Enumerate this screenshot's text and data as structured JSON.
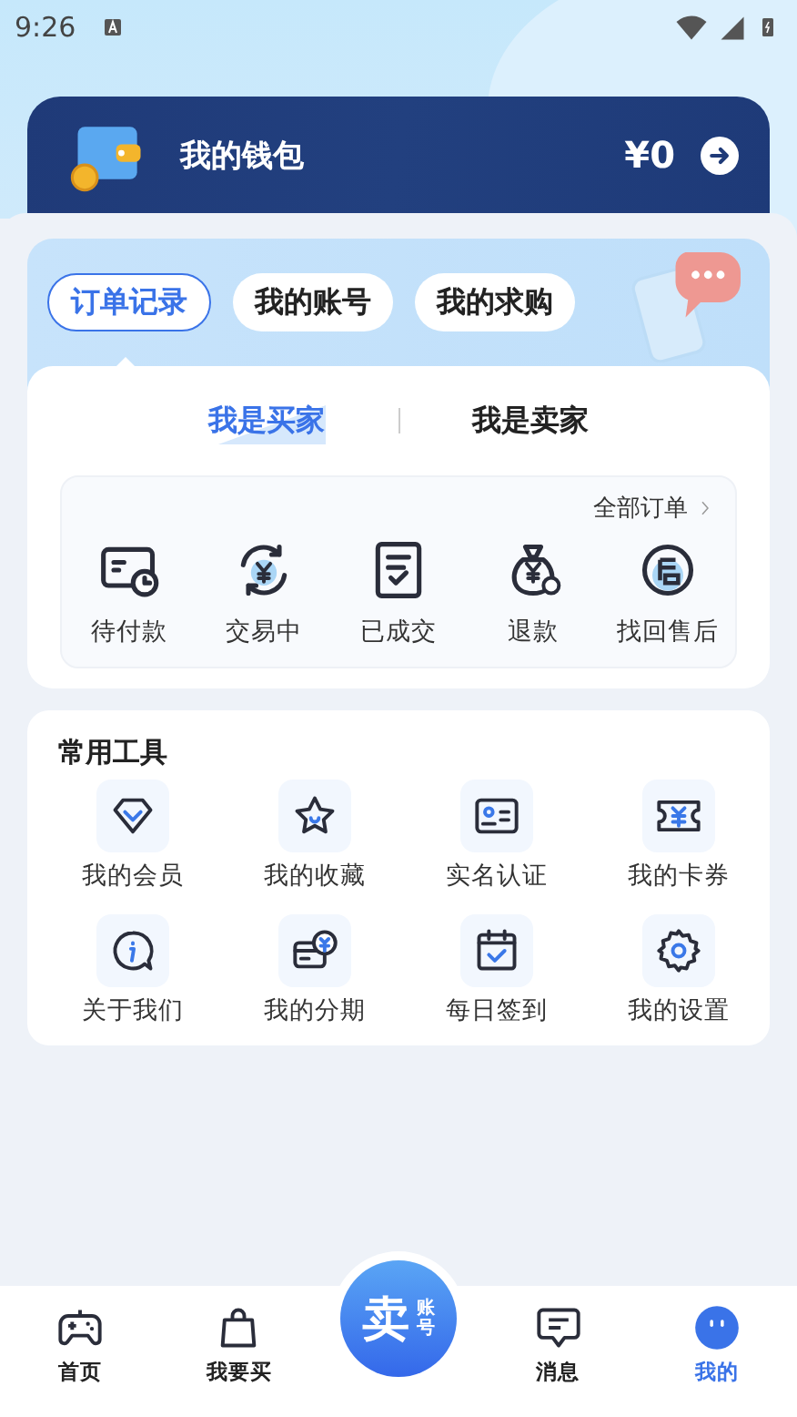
{
  "status_bar": {
    "time": "9:26"
  },
  "wallet": {
    "title": "我的钱包",
    "balance": "¥0"
  },
  "tabs": [
    {
      "label": "订单记录",
      "selected": true
    },
    {
      "label": "我的账号",
      "selected": false
    },
    {
      "label": "我的求购",
      "selected": false
    }
  ],
  "role_tabs": [
    {
      "label": "我是买家",
      "selected": true
    },
    {
      "label": "我是卖家",
      "selected": false
    }
  ],
  "orders": {
    "all_link": "全部订单",
    "items": [
      "待付款",
      "交易中",
      "已成交",
      "退款",
      "找回售后"
    ]
  },
  "tools": {
    "title": "常用工具",
    "items": [
      "我的会员",
      "我的收藏",
      "实名认证",
      "我的卡券",
      "关于我们",
      "我的分期",
      "每日签到",
      "我的设置"
    ]
  },
  "bottom_nav": {
    "items": [
      {
        "label": "首页",
        "selected": false
      },
      {
        "label": "我要买",
        "selected": false
      },
      {
        "label": "消息",
        "selected": false
      },
      {
        "label": "我的",
        "selected": true
      }
    ],
    "sell_button": {
      "big": "卖",
      "small": "账号"
    }
  }
}
